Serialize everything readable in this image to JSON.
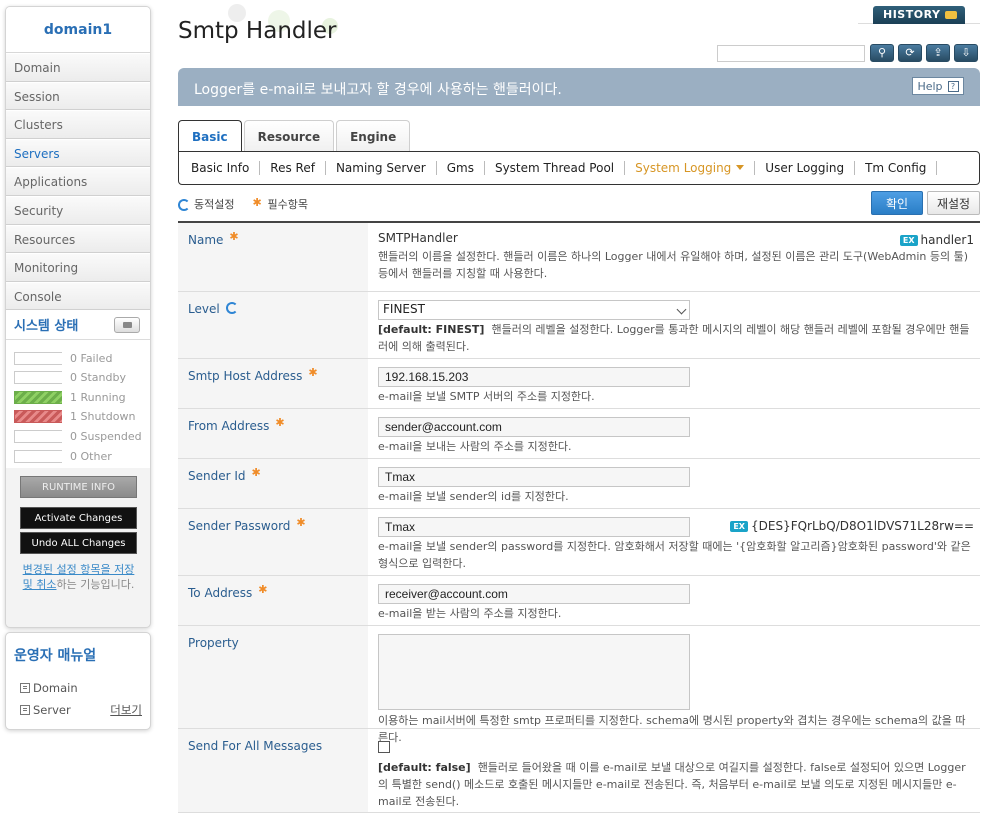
{
  "sidebar": {
    "domain": "domain1",
    "nav": [
      "Domain",
      "Session",
      "Clusters",
      "Servers",
      "Applications",
      "Security",
      "Resources",
      "Monitoring",
      "Console"
    ],
    "active_nav": "Servers",
    "status_title": "시스템 상태",
    "status": [
      {
        "count": "0",
        "label": "Failed"
      },
      {
        "count": "0",
        "label": "Standby"
      },
      {
        "count": "1",
        "label": "Running"
      },
      {
        "count": "1",
        "label": "Shutdown"
      },
      {
        "count": "0",
        "label": "Suspended"
      },
      {
        "count": "0",
        "label": "Other"
      }
    ],
    "runtime_info": "RUNTIME INFO",
    "activate": "Activate Changes",
    "undo": "Undo ALL Changes",
    "note_link": "변경된 설정 항목을 저장 및 취소",
    "note_rest": "하는 기능입니다."
  },
  "manual": {
    "title": "운영자 매뉴얼",
    "items": [
      "Domain",
      "Server"
    ],
    "more": "더보기"
  },
  "header": {
    "title": "Smtp Handler",
    "history": "HISTORY",
    "search_placeholder": "",
    "description": "Logger를 e-mail로 보내고자 할 경우에 사용하는 핸들러이다.",
    "help": "Help",
    "help_q": "?"
  },
  "tabs": [
    "Basic",
    "Resource",
    "Engine"
  ],
  "subtabs": [
    "Basic Info",
    "Res Ref",
    "Naming Server",
    "Gms",
    "System Thread Pool",
    "System Logging",
    "User Logging",
    "Tm Config"
  ],
  "legend": {
    "dynamic": "동적설정",
    "required": "필수항목"
  },
  "actions": {
    "confirm": "확인",
    "reset": "재설정"
  },
  "fields": {
    "name": {
      "label": "Name",
      "value": "SMTPHandler",
      "ex_value": "handler1",
      "ex": "EX",
      "help": "핸들러의 이름을 설정한다. 핸들러 이름은 하나의 Logger 내에서 유일해야 하며, 설정된 이름은 관리 도구(WebAdmin 등의 툴) 등에서 핸들러를 지칭할 때 사용한다."
    },
    "level": {
      "label": "Level",
      "value": "FINEST",
      "default": "[default: FINEST]",
      "help": "핸들러의 레벨을 설정한다. Logger를 통과한 메시지의 레벨이 해당 핸들러 레벨에 포함될 경우에만 핸들러에 의해 출력된다."
    },
    "smtp_host": {
      "label": "Smtp Host Address",
      "value": "192.168.15.203",
      "help": "e-mail을 보낼 SMTP 서버의 주소를 지정한다."
    },
    "from": {
      "label": "From Address",
      "value": "sender@account.com",
      "help": "e-mail을 보내는 사람의 주소를 지정한다."
    },
    "sender_id": {
      "label": "Sender Id",
      "value": "Tmax",
      "help": "e-mail을 보낼 sender의 id를 지정한다."
    },
    "sender_password": {
      "label": "Sender Password",
      "value": "Tmax",
      "ex": "EX",
      "ex_value": "{DES}FQrLbQ/D8O1lDVS71L28rw==",
      "help": "e-mail을 보낼 sender의 password를 지정한다. 암호화해서 저장할 때에는 '{암호화할 알고리즘}암호화된 password'와 같은 형식으로 입력한다."
    },
    "to": {
      "label": "To Address",
      "value": "receiver@account.com",
      "help": "e-mail을 받는 사람의 주소를 지정한다."
    },
    "property": {
      "label": "Property",
      "help": "이용하는 mail서버에 특정한 smtp 프로퍼티를 지정한다. schema에 명시된 property와 겹치는 경우에는 schema의 값을 따른다."
    },
    "send_all": {
      "label": "Send For All Messages",
      "default": "[default: false]",
      "help": "핸들러로 들어왔을 때 이를 e-mail로 보낼 대상으로 여길지를 설정한다. false로 설정되어 있으면 Logger의 특별한 send() 메소드로 호출된 메시지들만 e-mail로 전송된다. 즉, 처음부터 e-mail로 보낼 의도로 지정된 메시지들만 e-mail로 전송된다."
    }
  }
}
